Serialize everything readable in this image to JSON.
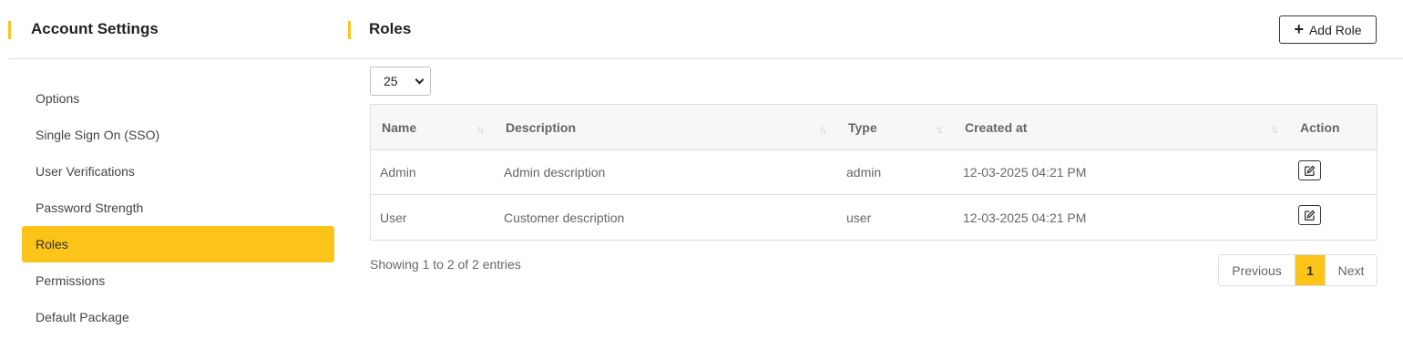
{
  "colors": {
    "accent": "#fcc419"
  },
  "sidebar": {
    "title": "Account Settings",
    "items": [
      {
        "label": "Options",
        "active": false
      },
      {
        "label": "Single Sign On (SSO)",
        "active": false
      },
      {
        "label": "User Verifications",
        "active": false
      },
      {
        "label": "Password Strength",
        "active": false
      },
      {
        "label": "Roles",
        "active": true
      },
      {
        "label": "Permissions",
        "active": false
      },
      {
        "label": "Default Package",
        "active": false
      }
    ]
  },
  "main": {
    "title": "Roles",
    "add_button_label": "Add Role",
    "page_size": "25",
    "table": {
      "columns": [
        "Name",
        "Description",
        "Type",
        "Created at",
        "Action"
      ],
      "rows": [
        {
          "name": "Admin",
          "description": "Admin description",
          "type": "admin",
          "created_at": "12-03-2025 04:21 PM"
        },
        {
          "name": "User",
          "description": "Customer description",
          "type": "user",
          "created_at": "12-03-2025 04:21 PM"
        }
      ]
    },
    "info": "Showing 1 to 2 of 2 entries",
    "pagination": {
      "previous": "Previous",
      "current": "1",
      "next": "Next"
    }
  }
}
